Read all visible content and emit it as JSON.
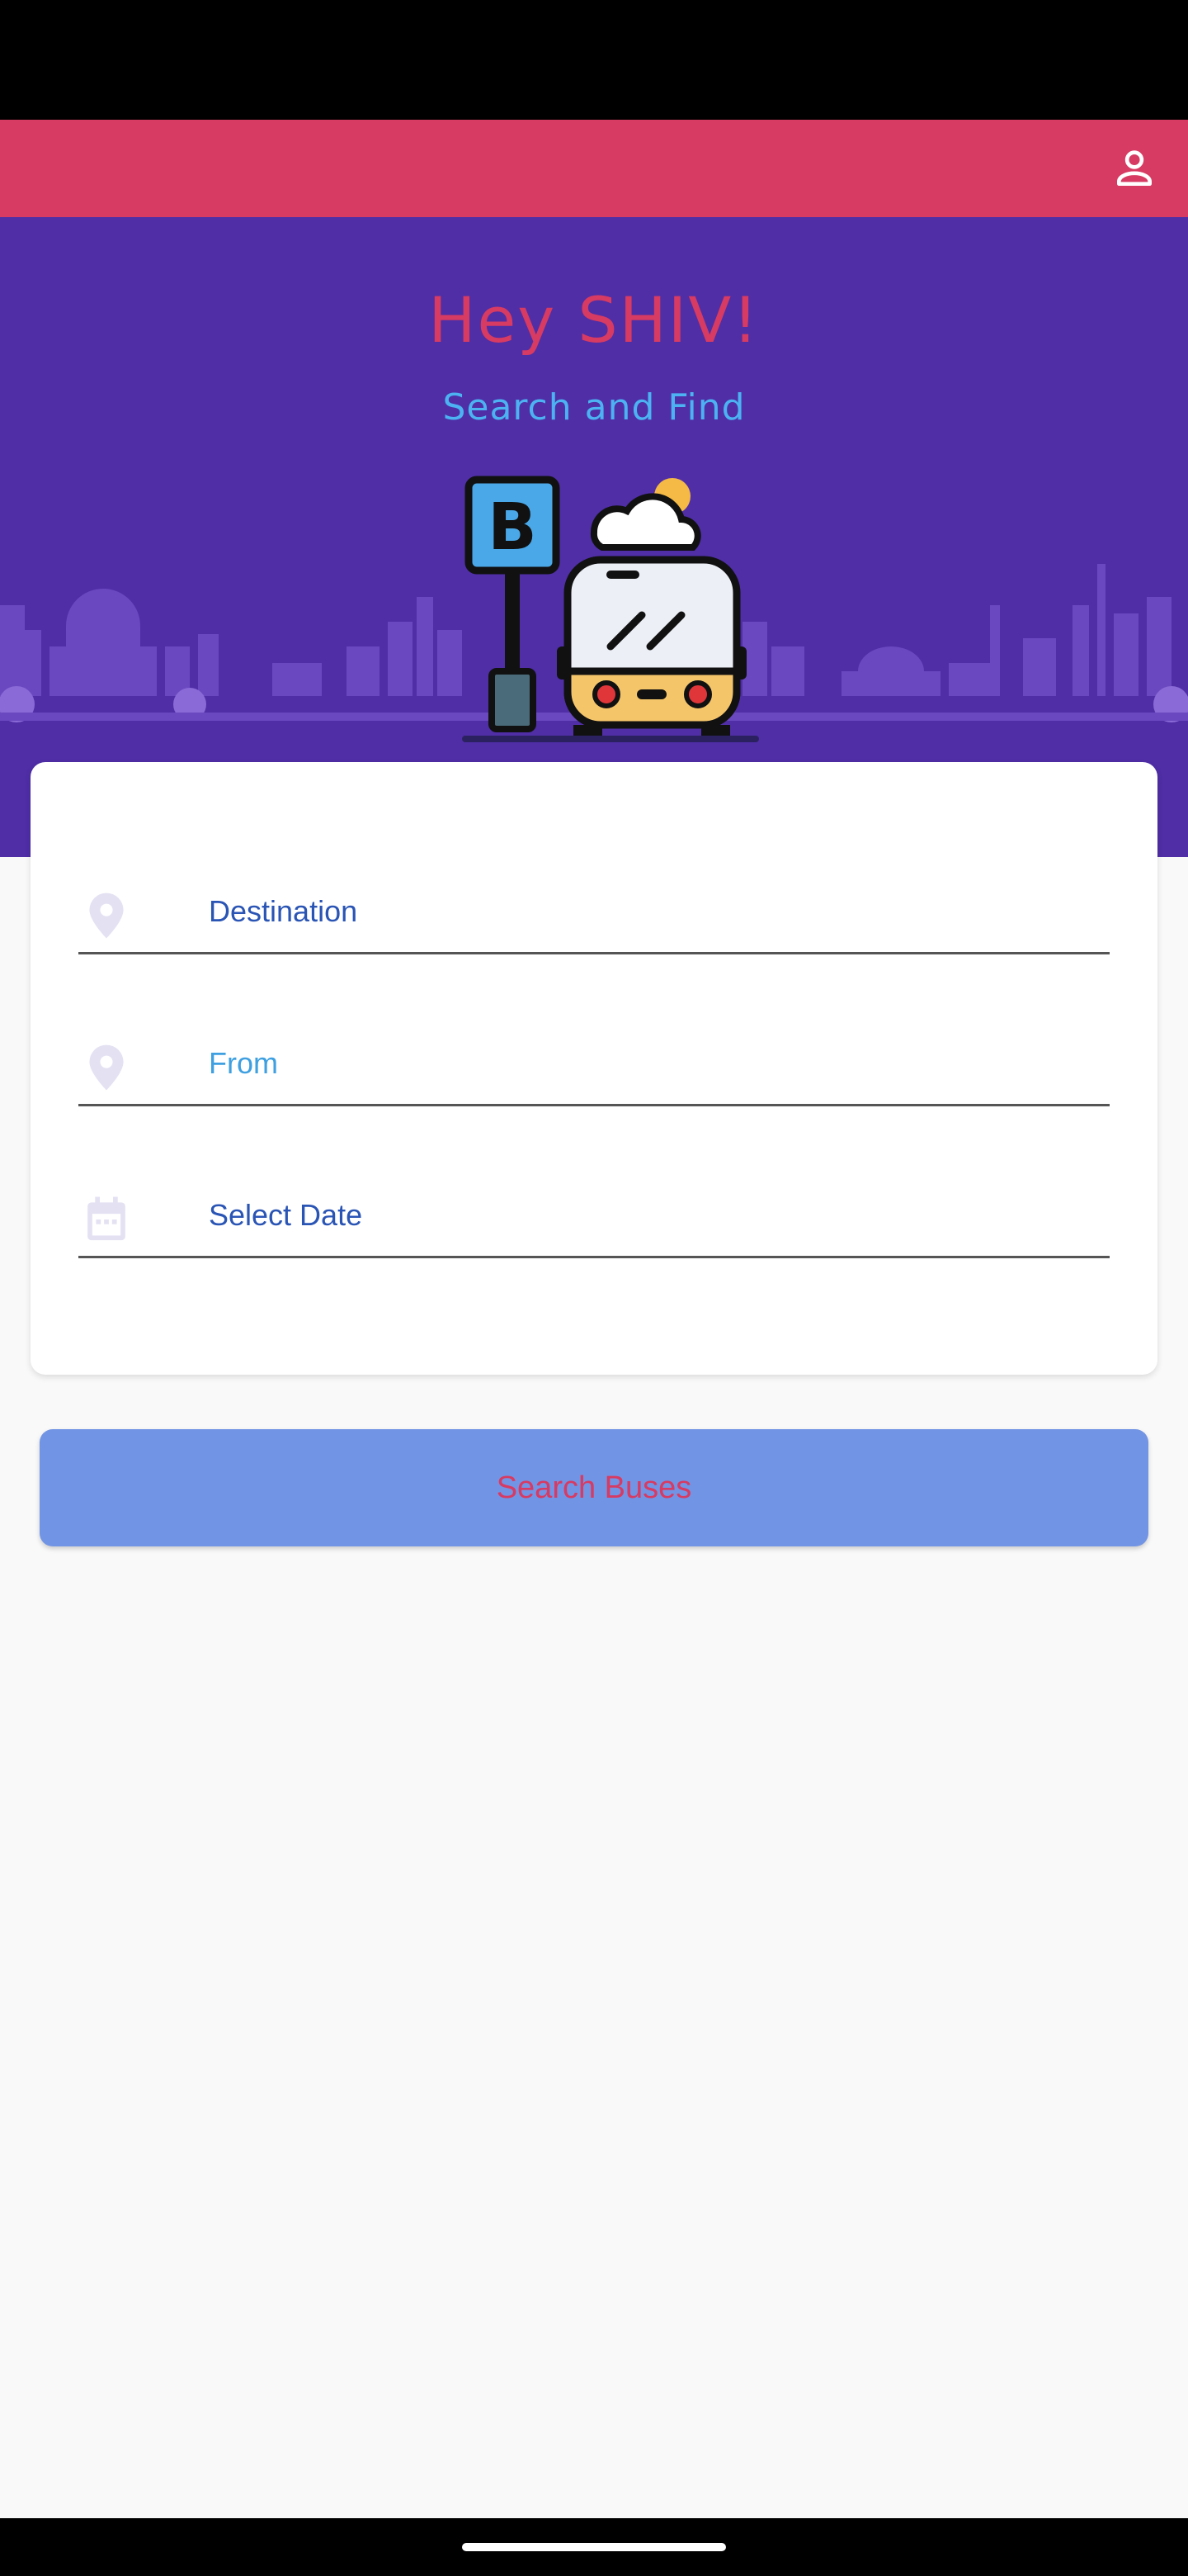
{
  "header": {
    "profile_icon": "person-outline-icon"
  },
  "colors": {
    "app_bar": "#d73a62",
    "hero": "#4f2ea6",
    "title": "#d73a62",
    "subtitle": "#4cb2f2",
    "button": "#7294e4"
  },
  "hero": {
    "title": "Hey SHIV!",
    "subtitle": "Search and Find",
    "illustration": "bus-stop-illustration"
  },
  "form": {
    "destination": {
      "label": "Destination",
      "icon": "location-pin-icon"
    },
    "from": {
      "label": "From",
      "icon": "location-pin-icon"
    },
    "date": {
      "label": "Select Date",
      "icon": "calendar-icon"
    }
  },
  "actions": {
    "search_label": "Search Buses"
  }
}
